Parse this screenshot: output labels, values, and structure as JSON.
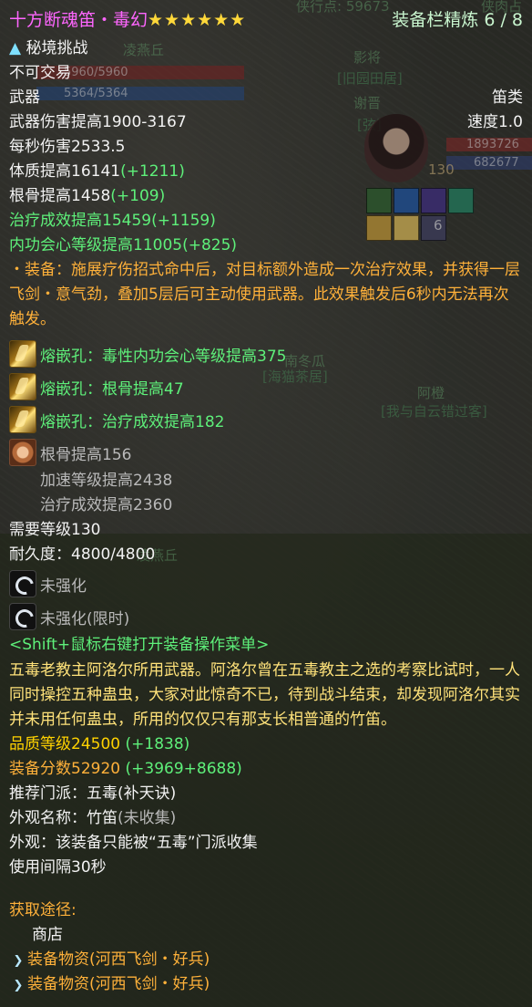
{
  "scene": {
    "labels": [
      "凌燕丘",
      "影将",
      "[旧园田居]",
      "谢晋",
      "[弦]",
      "南冬瓜",
      "[海猫茶居]",
      "阿橙",
      "[我与自云错过客]",
      "凌燕丘"
    ],
    "hp_values": [
      "5960/5960",
      "5364/5364",
      "1893726",
      "682677"
    ],
    "level_tag": "130",
    "buff_count": "6",
    "top_partial": "侠行点: 59673",
    "top_partial_right": "侠肉占"
  },
  "tooltip": {
    "title": "十方断魂笛・毒幻",
    "stars": "★★★★★★",
    "refine_label": "装备栏精炼 6 / 8",
    "challenge": "秘境挑战",
    "trade": "不可交易",
    "slot": "武器",
    "weapon_type": "笛类",
    "damage": "武器伤害提高1900-3167",
    "speed": "速度1.0",
    "dps": "每秒伤害2533.5",
    "attrs": [
      {
        "base": "体质提高16141",
        "bonus": "(+1211)",
        "color": "white"
      },
      {
        "base": "根骨提高1458",
        "bonus": "(+109)",
        "color": "white"
      },
      {
        "base": "治疗成效提高15459",
        "bonus": "(+1159)",
        "color": "green"
      },
      {
        "base": "内功会心等级提高11005",
        "bonus": "(+825)",
        "color": "green"
      }
    ],
    "effect": "・装备：施展疗伤招式命中后，对目标额外造成一次治疗效果，并获得一层飞剑・意气劲，叠加5层后可主动使用武器。此效果触发后6秒内无法再次触发。",
    "gems": [
      "熔嵌孔：毒性内功会心等级提高375",
      "熔嵌孔：根骨提高47",
      "熔嵌孔：治疗成效提高182"
    ],
    "stone": [
      "根骨提高156",
      "加速等级提高2438",
      "治疗成效提高2360"
    ],
    "required_level": "需要等级130",
    "durability": "耐久度：4800/4800",
    "enhance": [
      "未强化",
      "未强化(限时)"
    ],
    "hint": "<Shift+鼠标右键打开装备操作菜单>",
    "description": "五毒老教主阿洛尔所用武器。阿洛尔曾在五毒教主之选的考察比试时，一人同时操控五种蛊虫，大家对此惊奇不已，待到战斗结束，却发现阿洛尔其实并未用任何蛊虫，所用的仅仅只有那支长相普通的竹笛。",
    "quality_label": "品质等级24500",
    "quality_bonus": "(+1838)",
    "score_label": "装备分数52920",
    "score_bonus": "(+3969+8688)",
    "school_label": "推荐门派：",
    "school_value": "五毒(补天诀)",
    "appearance_label": "外观名称：",
    "appearance_value": "竹笛",
    "appearance_status": "(未收集)",
    "appearance_note": "外观：该装备只能被“五毒”门派收集",
    "interval": "使用间隔30秒",
    "source_title": "获取途径:",
    "source_shop": "商店",
    "sources": [
      "装备物资(河西飞剑・好兵)",
      "装备物资(河西飞剑・好兵)"
    ]
  },
  "colors": {
    "title": "#ff66ff",
    "bonus_green": "#5ef07a",
    "orange": "#ffb13a",
    "description": "#ffe27a"
  }
}
